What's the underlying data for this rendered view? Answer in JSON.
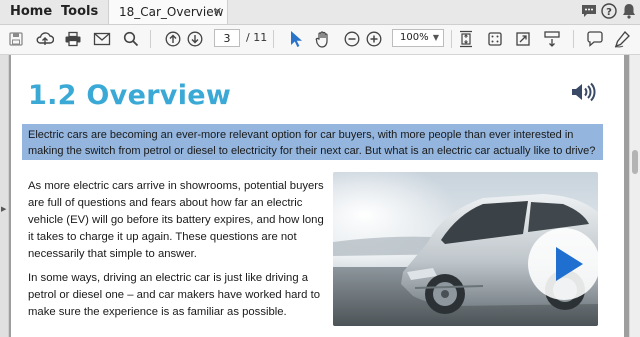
{
  "topnav": {
    "home": "Home",
    "tools": "Tools"
  },
  "tab": {
    "title": "18_Car_Overview",
    "close": "✕"
  },
  "toolbar": {
    "page_current": "3",
    "page_total": "/ 11",
    "zoom": "100%"
  },
  "document": {
    "heading": "1.2 Overview",
    "intro": "Electric cars are becoming an ever-more relevant option for car buyers, with more people than ever interested in making the switch from petrol or diesel to electricity for their next car. But what is an electric car actually like to drive?",
    "para1": "As more electric cars arrive in showrooms, potential buyers are full of questions and fears about how far an electric vehicle (EV) will go before its battery expires, and how long it takes to charge it up again. These questions are not necessarily that simple to answer.",
    "para2": "In some ways, driving an electric car is just like driving a petrol or diesel one – and car makers have worked hard to make sure the experience is as familiar as possible."
  },
  "colors": {
    "heading": "#3aa9d6",
    "highlight": "#93b5de",
    "play": "#1f6fd0"
  },
  "icons": [
    "save-icon",
    "upload-icon",
    "print-icon",
    "mail-icon",
    "search-icon",
    "page-up-icon",
    "page-down-icon",
    "select-cursor-icon",
    "hand-icon",
    "zoom-out-icon",
    "zoom-in-icon",
    "fit-page-icon",
    "rotate-icon",
    "fullscreen-icon",
    "scroll-mode-icon",
    "comment-icon",
    "sign-icon",
    "chat-icon",
    "help-icon",
    "bell-icon"
  ]
}
